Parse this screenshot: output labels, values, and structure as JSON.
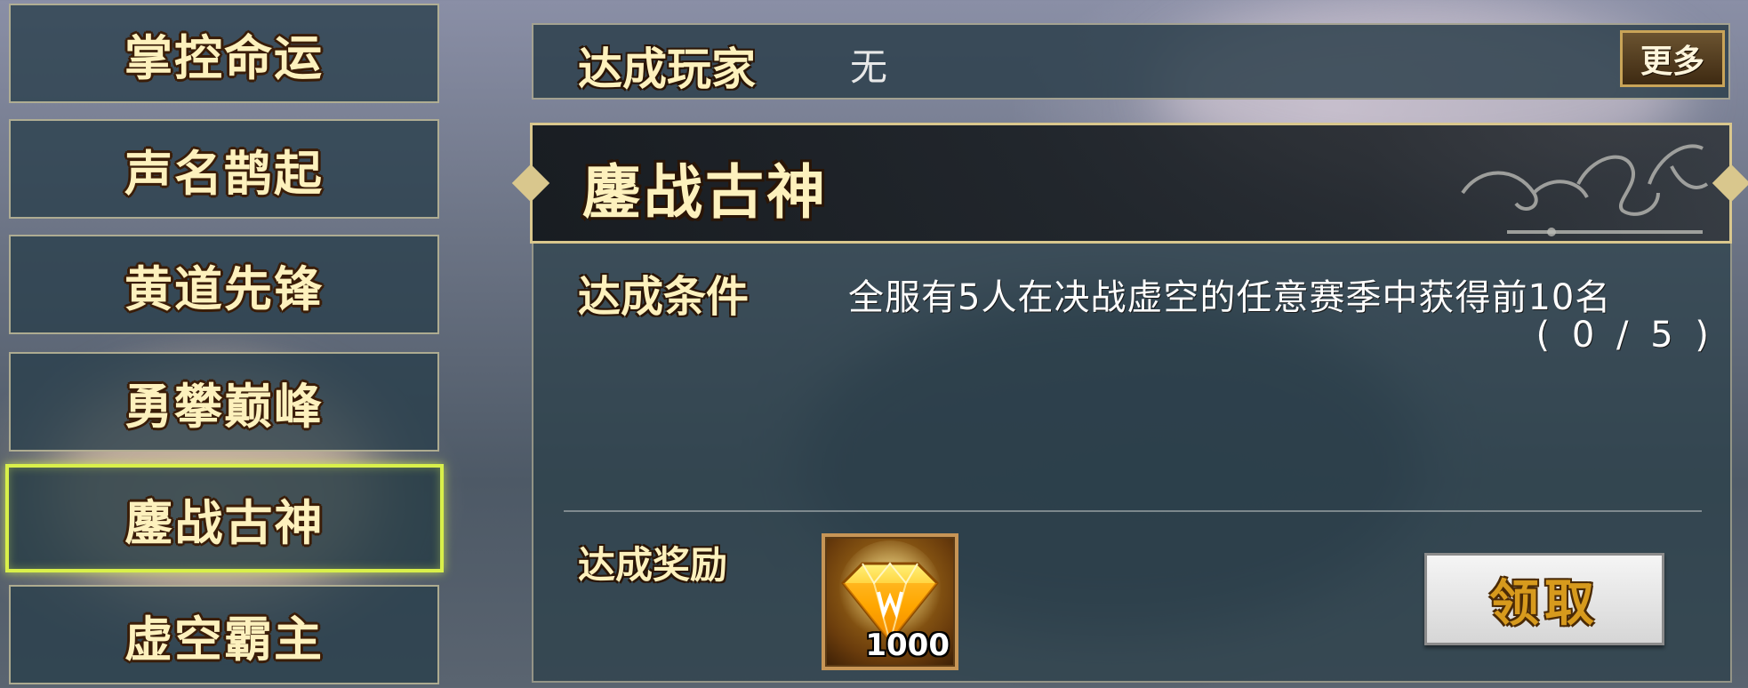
{
  "sidebar": {
    "items": [
      {
        "label": "掌控命运",
        "active": false
      },
      {
        "label": "声名鹊起",
        "active": false
      },
      {
        "label": "黄道先锋",
        "active": false
      },
      {
        "label": "勇攀巅峰",
        "active": false
      },
      {
        "label": "鏖战古神",
        "active": true
      },
      {
        "label": "虚空霸主",
        "active": false
      }
    ]
  },
  "achievers": {
    "label": "达成玩家",
    "value": "无",
    "more_label": "更多"
  },
  "achievement": {
    "title": "鏖战古神",
    "condition_label": "达成条件",
    "condition_text": "全服有5人在决战虚空的任意赛季中获得前10名",
    "progress_text": "( 0 / 5 )",
    "reward_label": "达成奖励",
    "reward": {
      "icon": "gold-diamond-icon",
      "count": "1000"
    },
    "claim_label": "领取"
  },
  "colors": {
    "label_text": "#fdf1bd",
    "active_border": "#d9f04a",
    "banner_border": "#d9c78d",
    "claim_text": "#d79a1d"
  }
}
